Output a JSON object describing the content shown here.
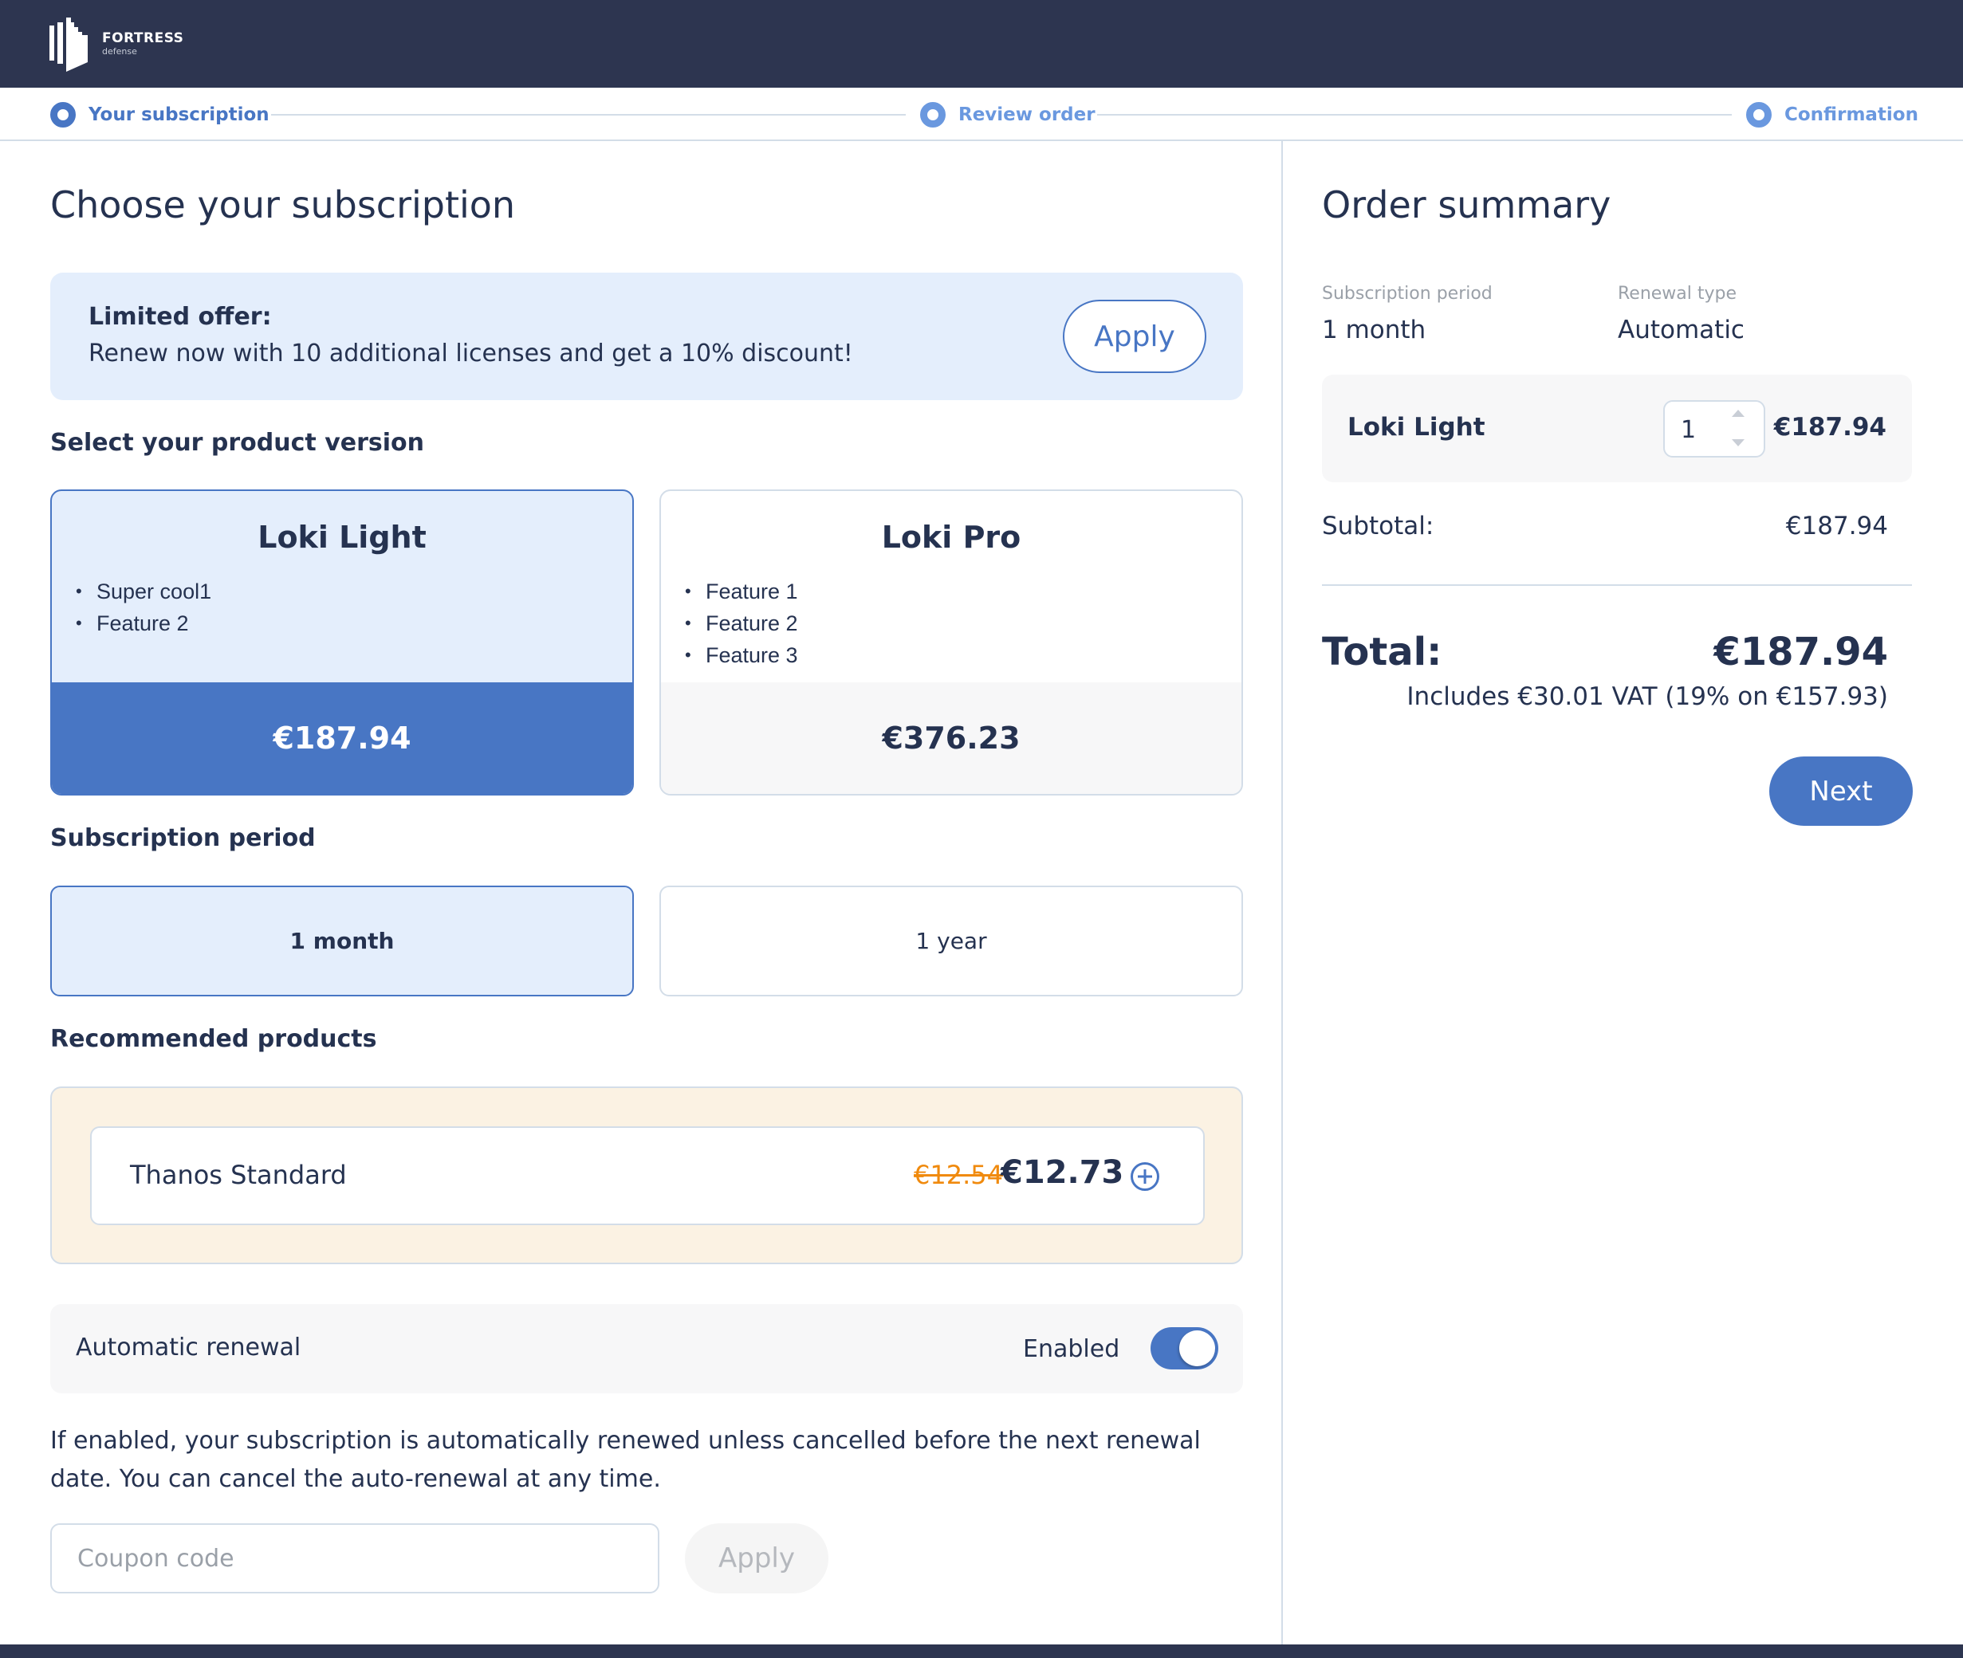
{
  "brand": {
    "name": "FORTRESS",
    "tagline": "defense"
  },
  "stepper": {
    "steps": [
      {
        "label": "Your subscription",
        "state": "active"
      },
      {
        "label": "Review order",
        "state": "upcoming"
      },
      {
        "label": "Confirmation",
        "state": "upcoming"
      }
    ]
  },
  "main": {
    "title": "Choose your subscription",
    "offer": {
      "title": "Limited offer:",
      "text": "Renew now with 10 additional licenses and get a 10% discount!",
      "button": "Apply"
    },
    "product_section_title": "Select your product version",
    "products": [
      {
        "name": "Loki Light",
        "features": [
          "Super cool1",
          "Feature 2"
        ],
        "price": "€187.94",
        "selected": true
      },
      {
        "name": "Loki Pro",
        "features": [
          "Feature 1",
          "Feature 2",
          "Feature 3"
        ],
        "price": "€376.23",
        "selected": false
      }
    ],
    "period_section_title": "Subscription period",
    "periods": [
      {
        "label": "1 month",
        "selected": true
      },
      {
        "label": "1 year",
        "selected": false
      }
    ],
    "recommended_section_title": "Recommended products",
    "recommended": [
      {
        "name": "Thanos Standard",
        "old_price": "€12.54",
        "price": "€12.73",
        "action_icon": "plus-circle-icon"
      }
    ],
    "auto_renewal": {
      "label": "Automatic renewal",
      "status": "Enabled",
      "enabled": true,
      "description": "If enabled, your subscription is automatically renewed unless cancelled before the next renewal date. You can cancel the auto-renewal at any time."
    },
    "coupon": {
      "placeholder": "Coupon code",
      "value": "",
      "button": "Apply"
    }
  },
  "summary": {
    "title": "Order summary",
    "period_label": "Subscription period",
    "period_value": "1 month",
    "renewal_label": "Renewal type",
    "renewal_value": "Automatic",
    "line_items": [
      {
        "name": "Loki Light",
        "quantity": "1",
        "price": "€187.94"
      }
    ],
    "subtotal_label": "Subtotal:",
    "subtotal_value": "€187.94",
    "total_label": "Total:",
    "total_value": "€187.94",
    "vat_note": "Includes €30.01 VAT (19% on €157.93)",
    "next_button": "Next"
  },
  "colors": {
    "header_bg": "#2d3550",
    "accent": "#4876c4",
    "offer_bg": "#e4eefc",
    "recommended_bg": "#fbf2e3",
    "strike_price": "#f08a0d",
    "text": "#253250"
  }
}
